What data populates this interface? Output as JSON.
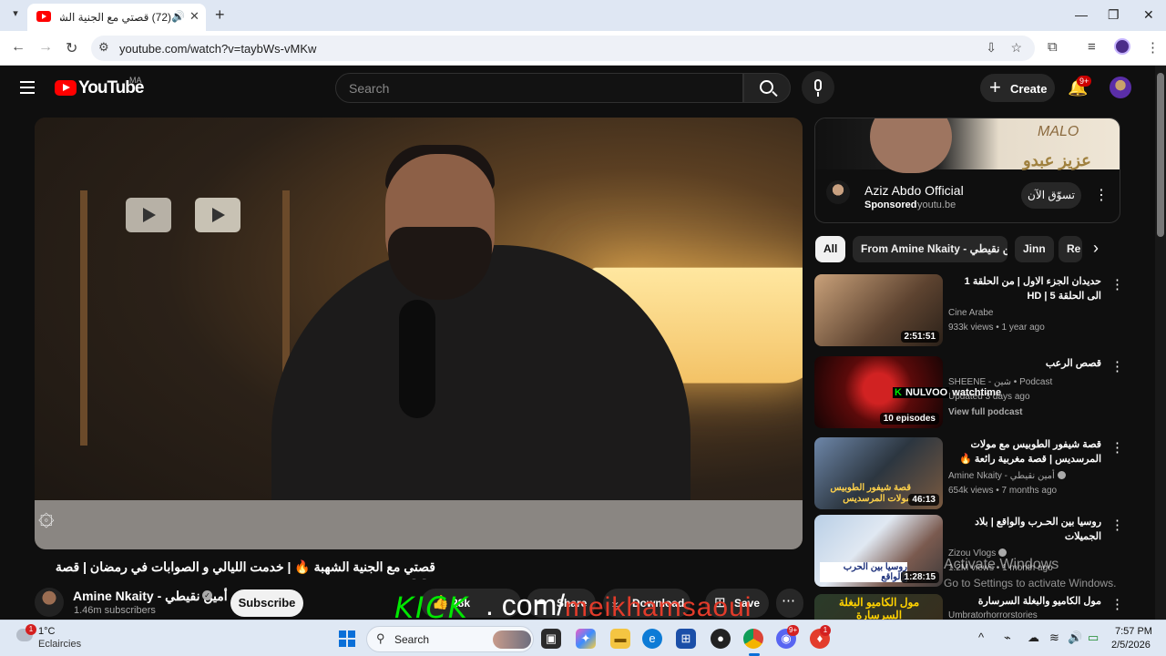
{
  "browser": {
    "tab_title": "(72) قصتي مع الجنية الشهبة",
    "url": "youtube.com/watch?v=taybWs-vMKw"
  },
  "youtube": {
    "logo_text": "YouTube",
    "country": "MA",
    "search_placeholder": "Search",
    "create_label": "Create",
    "notif_count": "9+"
  },
  "video": {
    "title": "قصتي مع الجنية الشهبة 🔥 | خدمت الليالي و الصوابات في رمضان | قصة حقيقية",
    "channel": "Amine Nkaity - أمين نقيطي",
    "verified_mark": "✓",
    "subscribers": "1.46m subscribers",
    "subscribe_label": "Subscribe",
    "likes": "28k",
    "share_label": "Share",
    "download_label": "Download",
    "save_label": "Save",
    "overlay_kick": "KICK",
    "overlay_com": ". com/",
    "overlay_user": "meikhamsaoui"
  },
  "ad": {
    "banner_logo": "MALO",
    "banner_arabic": "عزيز عبدو",
    "title": "Aziz Abdo Official",
    "sponsored": "Sponsored",
    "domain": "youtu.be",
    "cta": "تسوّق الآن"
  },
  "chips": [
    "All",
    "From Amine Nkaity - أمين نقيطي",
    "Jinn",
    "Re"
  ],
  "recommendations": [
    {
      "title": "حديدان الجزء الاول | من الحلقة 1 الى الحلقة HD | 5",
      "channel": "Cine Arabe",
      "meta": "933k views • 1 year ago",
      "duration": "2:51:51"
    },
    {
      "title": "قصص الرعب",
      "channel": "SHEENE - شين • Podcast",
      "meta": "Updated 3 days ago",
      "extra": "View full podcast",
      "duration": "10 episodes"
    },
    {
      "title": "قصة شيفور الطوبيس مع مولات المرسديس | قصة مغربية رائعة 🔥",
      "channel": "Amine Nkaity - أمين نقيطي",
      "meta": "654k views • 7 months ago",
      "duration": "46:13",
      "thumb_text": "قصة شيفور الطوبيس مولات المرسديس"
    },
    {
      "title": "روسيا بين الحـرب والواقع | بلاد الجميلات",
      "channel": "Zizou Vlogs",
      "meta": "1.2M views • 1 month ago",
      "duration": "1:28:15",
      "thumb_text": "روسيا بين الحرب والواقع"
    },
    {
      "title": "مول الكاميو والبغلة السرسارة",
      "channel": "Umbratorhorrorstories",
      "meta": "",
      "duration": "",
      "thumb_text": "مول الكاميو البغلة السرسارة"
    }
  ],
  "overlay_watchtime": {
    "k": "K",
    "name": "NULVOO",
    "label": "watchtime"
  },
  "activate": {
    "line1": "Activate Windows",
    "line2": "Go to Settings to activate Windows."
  },
  "taskbar": {
    "temp": "1°C",
    "weather": "Eclaircies",
    "weather_badge": "1",
    "search_label": "Search",
    "chrome_badge": "",
    "discord_badge": "9+",
    "app_badge": "1",
    "time": "7:57 PM",
    "date": "2/5/2026"
  },
  "colors": {
    "yt_red": "#ff0000",
    "background": "#0f0f0f",
    "kick_green": "#00e701",
    "overlay_red": "#e23b2a"
  }
}
